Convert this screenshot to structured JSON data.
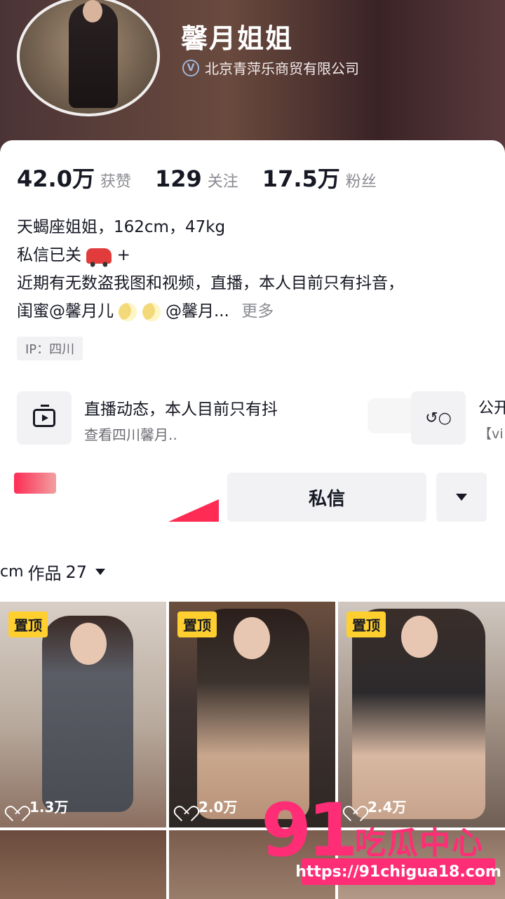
{
  "profile": {
    "name": "馨月姐姐",
    "company": "北京青萍乐商贸有限公司"
  },
  "stats": [
    {
      "num": "42.0万",
      "label": "获赞"
    },
    {
      "num": "129",
      "label": "关注"
    },
    {
      "num": "17.5万",
      "label": "粉丝"
    }
  ],
  "bio": {
    "line1": "天蝎座姐姐，162cm，47kg",
    "line2_text": "私信已关",
    "line2_suffix": "+",
    "line3": "近期有无数盗我图和视频，直播，本人目前只有抖音，",
    "line4_prefix": "闺蜜@馨月儿",
    "line4_mid": "@馨月...",
    "more": "更多"
  },
  "ip": "IP：四川",
  "live": {
    "title": "直播动态，本人目前只有抖",
    "subtitle": "查看四川馨月..",
    "group_title": "公开",
    "group_sub": "【vi"
  },
  "actions": {
    "message": "私信"
  },
  "works": {
    "cm_label": "cm",
    "label": "作品",
    "count": "27"
  },
  "videos": [
    {
      "pinned": "置顶",
      "likes": "1.3万"
    },
    {
      "pinned": "置顶",
      "likes": "2.0万"
    },
    {
      "pinned": "置顶",
      "likes": "2.4万"
    }
  ],
  "watermark": {
    "number": "91",
    "text": "吃瓜中心",
    "url": "https://91chigua18.com"
  },
  "colors": {
    "accent": "#fe2c55",
    "pinned_badge": "#fecf2f",
    "watermark": "#ff2d75"
  }
}
